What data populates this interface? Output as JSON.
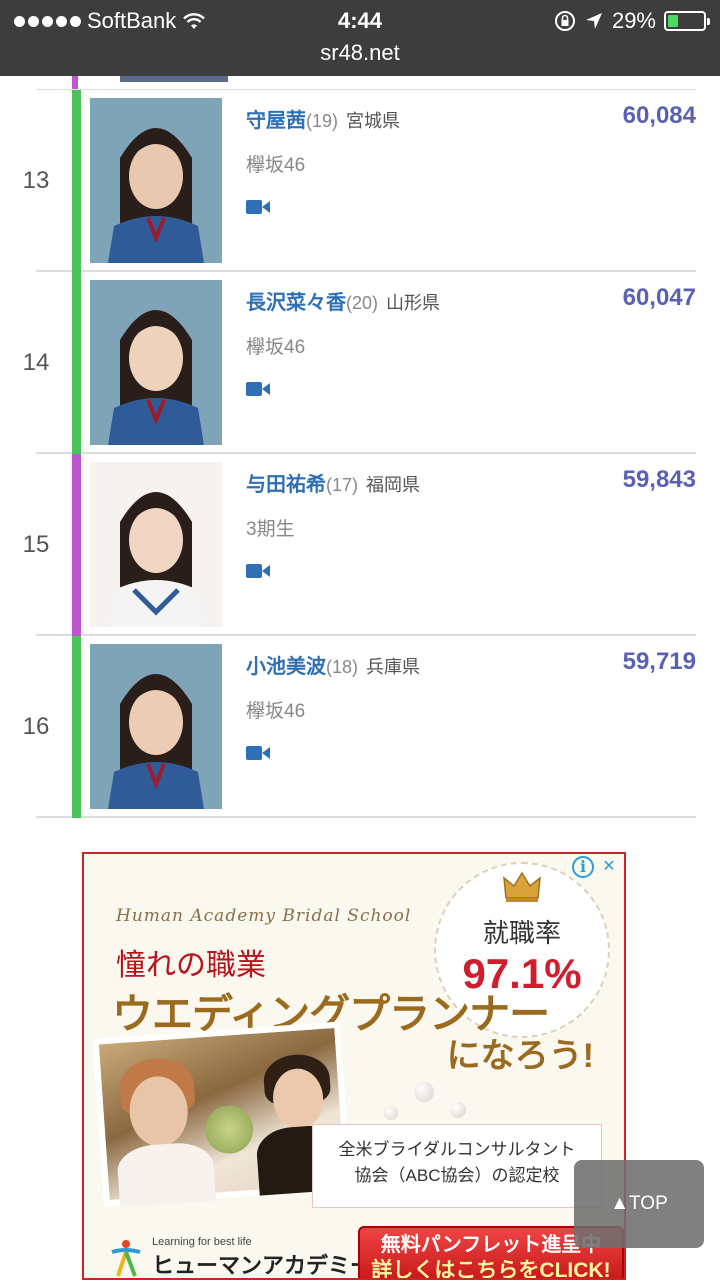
{
  "status_bar": {
    "carrier": "SoftBank",
    "time": "4:44",
    "battery": "29%",
    "battery_level": 0.29,
    "url": "sr48.net"
  },
  "ranking": [
    {
      "rank": "13",
      "name": "守屋茜",
      "age": "(19)",
      "prefecture": "宮城県",
      "group": "欅坂46",
      "votes": "60,084",
      "bar_color": "#4cc35a",
      "icon": "video-camera-icon"
    },
    {
      "rank": "14",
      "name": "長沢菜々香",
      "age": "(20)",
      "prefecture": "山形県",
      "group": "欅坂46",
      "votes": "60,047",
      "bar_color": "#4cc35a",
      "icon": "video-camera-icon"
    },
    {
      "rank": "15",
      "name": "与田祐希",
      "age": "(17)",
      "prefecture": "福岡県",
      "group": "3期生",
      "votes": "59,843",
      "bar_color": "#c054d0",
      "icon": "video-camera-icon"
    },
    {
      "rank": "16",
      "name": "小池美波",
      "age": "(18)",
      "prefecture": "兵庫県",
      "group": "欅坂46",
      "votes": "59,719",
      "bar_color": "#4cc35a",
      "icon": "video-camera-icon"
    }
  ],
  "ad": {
    "school": "Human Academy Bridal School",
    "headline": "憧れの職業",
    "title": "ウエディングプランナー",
    "subtitle": "になろう!",
    "badge_label": "就職率",
    "badge_value": "97.1%",
    "cert_line1": "全米ブライダルコンサルタント",
    "cert_line2": "協会（ABC協会）の認定校",
    "logo_tagline": "Learning for best life",
    "logo_name": "ヒューマンアカデミー",
    "cta_line1": "無料パンフレット進呈中",
    "cta_line2": "詳しくはこちらをCLICK!",
    "info_icon": "info-icon",
    "close_icon": "close-icon"
  },
  "to_top": {
    "label": "▲TOP"
  }
}
